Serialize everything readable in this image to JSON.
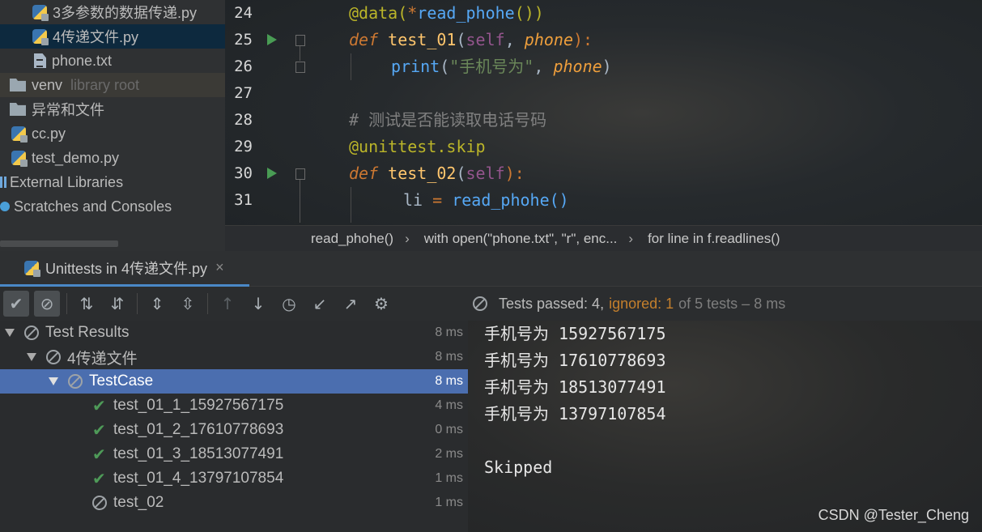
{
  "project_tree": {
    "items": [
      {
        "label": "3多参数的数据传递.py",
        "icon": "python-file-icon"
      },
      {
        "label": "4传递文件.py",
        "icon": "python-file-icon"
      },
      {
        "label": "phone.txt",
        "icon": "text-file-icon"
      },
      {
        "label": "venv",
        "sub": "library root",
        "icon": "folder-icon"
      },
      {
        "label": "异常和文件",
        "icon": "folder-icon"
      },
      {
        "label": "cc.py",
        "icon": "python-file-icon"
      },
      {
        "label": "test_demo.py",
        "icon": "python-file-icon"
      },
      {
        "label": "External Libraries",
        "icon": "library-icon"
      },
      {
        "label": "Scratches and Consoles",
        "icon": "scratches-icon"
      }
    ]
  },
  "editor": {
    "line_numbers": [
      "24",
      "25",
      "26",
      "27",
      "28",
      "29",
      "30",
      "31"
    ],
    "code": {
      "l24_deco": "@data(",
      "l24_star": "*",
      "l24_call": "read_phohe",
      "l24_end": "())",
      "l25_def": "def",
      "l25_fn": "test_01",
      "l25_open": "(",
      "l25_self": "self",
      "l25_comma": ", ",
      "l25_param": "phone",
      "l25_close": "):",
      "l26_print": "print",
      "l26_open": "(",
      "l26_str": "\"手机号为\"",
      "l26_comma": ", ",
      "l26_param": "phone",
      "l26_close": ")",
      "l28_comment": "# 测试是否能读取电话号码",
      "l29_deco": "@unittest.skip",
      "l30_def": "def",
      "l30_fn": "test_02",
      "l30_open": "(",
      "l30_self": "self",
      "l30_close": "):",
      "l31_var": "li",
      "l31_eq": " = ",
      "l31_call": "read_phohe()"
    },
    "breadcrumb": [
      "read_phohe()",
      "with open(\"phone.txt\", \"r\", enc...",
      "for line in f.readlines()"
    ],
    "breadcrumb_sep": "›"
  },
  "run_window": {
    "tab_label": "Unittests in 4传递文件.py",
    "tab_close": "×",
    "status": {
      "passed": "Tests passed: 4,",
      "ignored": "ignored: 1",
      "rest": "of 5 tests – 8 ms"
    },
    "toolbar_icons": [
      "show-passed-icon",
      "show-ignored-icon",
      "sort-alpha-icon",
      "sort-duration-icon",
      "expand-all-icon",
      "collapse-all-icon",
      "prev-failed-icon",
      "next-failed-icon",
      "history-icon",
      "import-icon",
      "export-icon",
      "settings-icon"
    ],
    "results": [
      {
        "label": "Test Results",
        "time": "8 ms",
        "status": "ignored"
      },
      {
        "label": "4传递文件",
        "time": "8 ms",
        "status": "ignored"
      },
      {
        "label": "TestCase",
        "time": "8 ms",
        "status": "ignored"
      },
      {
        "label": "test_01_1_15927567175",
        "time": "4 ms",
        "status": "passed"
      },
      {
        "label": "test_01_2_17610778693",
        "time": "0 ms",
        "status": "passed"
      },
      {
        "label": "test_01_3_18513077491",
        "time": "2 ms",
        "status": "passed"
      },
      {
        "label": "test_01_4_13797107854",
        "time": "1 ms",
        "status": "passed"
      },
      {
        "label": "test_02",
        "time": "1 ms",
        "status": "ignored"
      }
    ],
    "console_lines": [
      "手机号为 15927567175",
      "手机号为 17610778693",
      "手机号为 18513077491",
      "手机号为 13797107854",
      "",
      "Skipped"
    ]
  },
  "watermark": "CSDN @Tester_Cheng",
  "colors": {
    "selection": "#4b6eaf",
    "passed": "#4e9a58",
    "ignored_text": "#c47f2c",
    "run_arrow": "#499c54"
  }
}
